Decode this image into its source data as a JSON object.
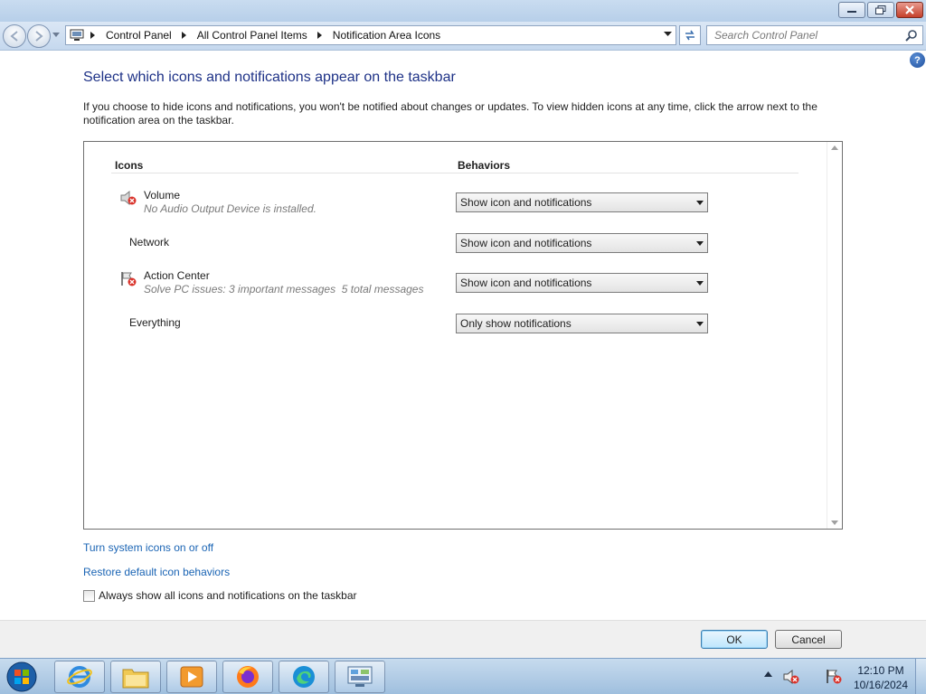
{
  "window": {
    "controls": [
      "minimize-icon",
      "restore-icon",
      "close-icon"
    ]
  },
  "address_bar": {
    "breadcrumbs": [
      "Control Panel",
      "All Control Panel Items",
      "Notification Area Icons"
    ],
    "search_placeholder": "Search Control Panel"
  },
  "page": {
    "heading": "Select which icons and notifications appear on the taskbar",
    "intro": "If you choose to hide icons and notifications, you won't be notified about changes or updates. To view hidden icons at any time, click the arrow next to the notification area on the taskbar.",
    "columns": {
      "icons": "Icons",
      "behaviors": "Behaviors"
    },
    "rows": [
      {
        "name": "Volume",
        "description": "No Audio Output Device is installed.",
        "icon": "speaker-muted-icon",
        "behavior": "Show icon and notifications"
      },
      {
        "name": "Network",
        "description": "",
        "icon": "",
        "behavior": "Show icon and notifications"
      },
      {
        "name": "Action Center",
        "description": "Solve PC issues: 3 important messages  5 total messages",
        "icon": "action-center-flag-icon",
        "behavior": "Show icon and notifications"
      },
      {
        "name": "Everything",
        "description": "",
        "icon": "",
        "behavior": "Only show notifications"
      }
    ],
    "links": {
      "turn_system_icons": "Turn system icons on or off",
      "restore_defaults": "Restore default icon behaviors"
    },
    "always_show_label": "Always show all icons and notifications on the taskbar",
    "always_show_checked": false
  },
  "buttons": {
    "ok": "OK",
    "cancel": "Cancel"
  },
  "taskbar": {
    "apps": [
      "internet-explorer-icon",
      "file-explorer-icon",
      "media-player-icon",
      "firefox-icon",
      "edge-icon",
      "control-panel-icon"
    ],
    "clock_time": "12:10 PM",
    "clock_date": "10/16/2024"
  },
  "colors": {
    "heading": "#1e3287",
    "link": "#1a64b4",
    "taskbar": "#a9c6e3"
  }
}
